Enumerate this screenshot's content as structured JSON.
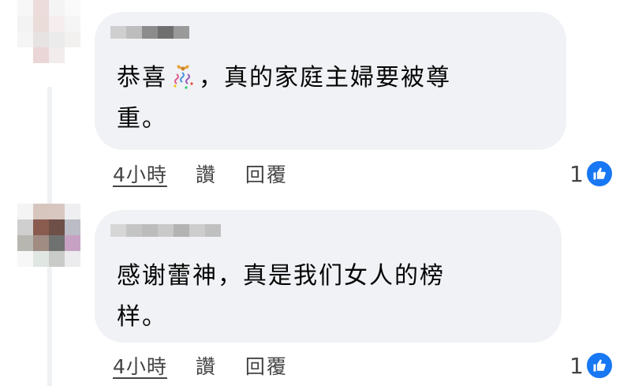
{
  "comments": [
    {
      "text_before": "恭喜",
      "emoji": "confetti-ball",
      "text_after": "，真的家庭主婦要被尊",
      "text_line2": "重。",
      "time": "4小時",
      "like_label": "讚",
      "reply_label": "回覆",
      "reaction_count": "1"
    },
    {
      "text_line1": "感谢蕾神，真是我们女人的榜",
      "text_line2": "样。",
      "time": "4小時",
      "like_label": "讚",
      "reply_label": "回覆",
      "reaction_count": "1"
    }
  ],
  "colors": {
    "bubble": "#f0f2f5",
    "like_blue": "#1877f2",
    "meta_text": "#444444"
  },
  "icons": {
    "reaction": "thumbs-up-icon",
    "emoji": "confetti-icon"
  }
}
